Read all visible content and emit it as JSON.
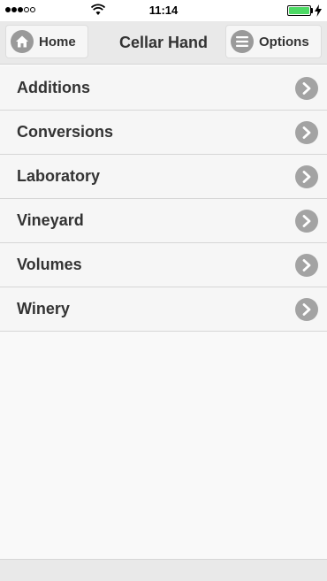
{
  "status_bar": {
    "time": "11:14",
    "signal_filled": 3,
    "signal_total": 5,
    "battery_level": 1.0,
    "battery_color": "#4cd964",
    "icons": [
      "wifi-icon",
      "battery-icon",
      "charging-icon"
    ]
  },
  "header": {
    "title": "Cellar Hand",
    "home_label": "Home",
    "home_icon": "home-icon",
    "options_label": "Options",
    "options_icon": "menu-icon"
  },
  "menu": {
    "items": [
      {
        "label": "Additions",
        "icon": "chevron-right-icon"
      },
      {
        "label": "Conversions",
        "icon": "chevron-right-icon"
      },
      {
        "label": "Laboratory",
        "icon": "chevron-right-icon"
      },
      {
        "label": "Vineyard",
        "icon": "chevron-right-icon"
      },
      {
        "label": "Volumes",
        "icon": "chevron-right-icon"
      },
      {
        "label": "Winery",
        "icon": "chevron-right-icon"
      }
    ]
  },
  "colors": {
    "header_background": "#e9e9e9",
    "list_background": "#f6f6f6",
    "icon_gray": "#a3a3a3",
    "text": "#333333"
  }
}
